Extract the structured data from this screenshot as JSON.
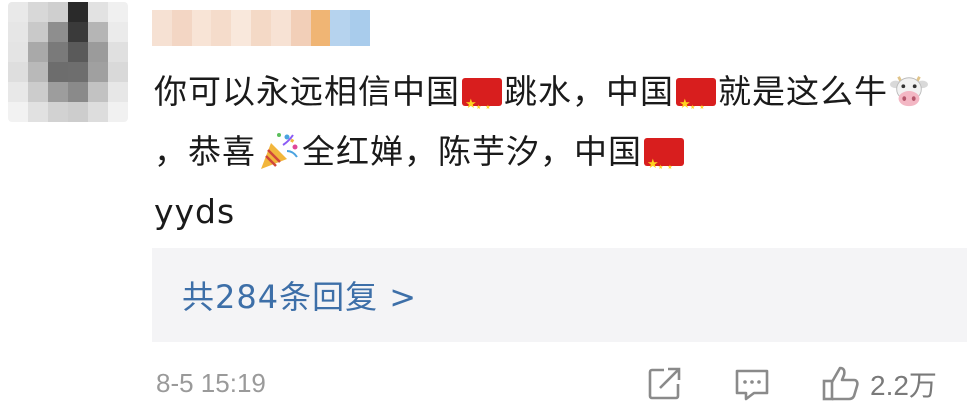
{
  "comment": {
    "segments": [
      "你可以永远相信中国",
      "跳水，中国",
      "就是这么牛",
      "，恭喜",
      "全红婵，陈芋汐，中国",
      "yyds"
    ],
    "emoji": {
      "flag": "china-flag-icon",
      "cow": "cow-face-icon",
      "party": "party-popper-icon"
    }
  },
  "replies": {
    "label": "共284条回复 >"
  },
  "footer": {
    "timestamp": "8-5 15:19",
    "like_count": "2.2万",
    "icons": [
      "share-icon",
      "comment-icon",
      "like-icon"
    ]
  },
  "colors": {
    "link": "#3d6fa8",
    "meta": "#9a9a9a",
    "replies_bg": "#f4f4f6",
    "flag_red": "#d81e1e"
  }
}
